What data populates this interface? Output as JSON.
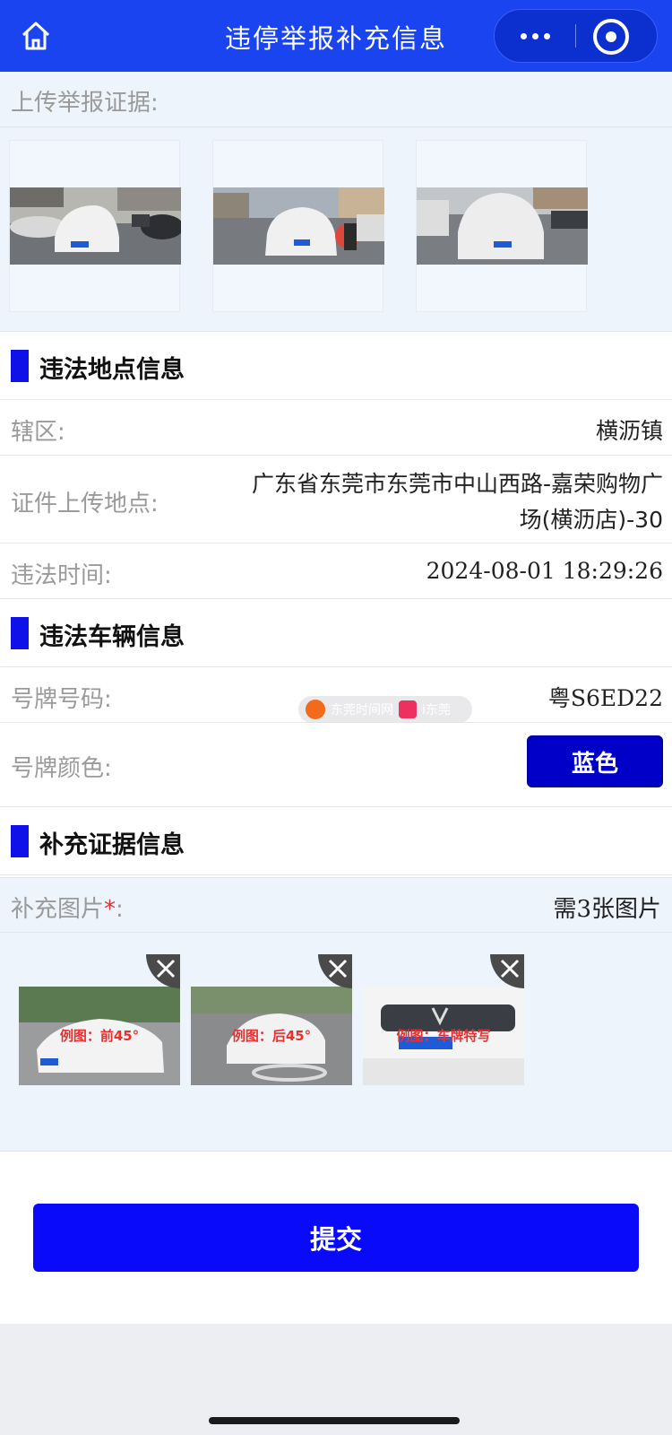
{
  "nav": {
    "title": "违停举报补充信息",
    "icons": {
      "home": "home-icon",
      "more": "more-dots-icon",
      "close": "mini-program-close-icon"
    }
  },
  "upload": {
    "label": "上传举报证据:",
    "photos": [
      {
        "name": "evidence-photo-1"
      },
      {
        "name": "evidence-photo-2"
      },
      {
        "name": "evidence-photo-3"
      }
    ]
  },
  "location_section": {
    "title": "违法地点信息",
    "district_label": "辖区:",
    "district_value": "横沥镇",
    "place_label": "证件上传地点:",
    "place_value_line1": "广东省东莞市东莞市中山西路-嘉荣购物广",
    "place_value_line2": "场(横沥店)-30",
    "time_label": "违法时间:",
    "time_value": "2024-08-01 18:29:26"
  },
  "vehicle_section": {
    "title": "违法车辆信息",
    "plate_label": "号牌号码:",
    "plate_value": "粤S6ED22",
    "color_label": "号牌颜色:",
    "color_value": "蓝色"
  },
  "supplement_section": {
    "title": "补充证据信息",
    "pics_label": "补充图片",
    "pics_required_mark": "*",
    "pics_colon": ":",
    "pics_hint": "需3张图片",
    "images": [
      {
        "caption": "例图：前45°"
      },
      {
        "caption": "例图：后45°"
      },
      {
        "caption": "例图：车牌特写"
      }
    ]
  },
  "submit_label": "提交",
  "watermark": {
    "text1": "东莞时间网",
    "text2": "i东莞"
  },
  "colors": {
    "nav_blue": "#1a44f0",
    "accent_blue": "#0a0afa",
    "plate_blue": "#0000c8",
    "required_red": "#e03030",
    "section_bar": "#1010e8"
  }
}
